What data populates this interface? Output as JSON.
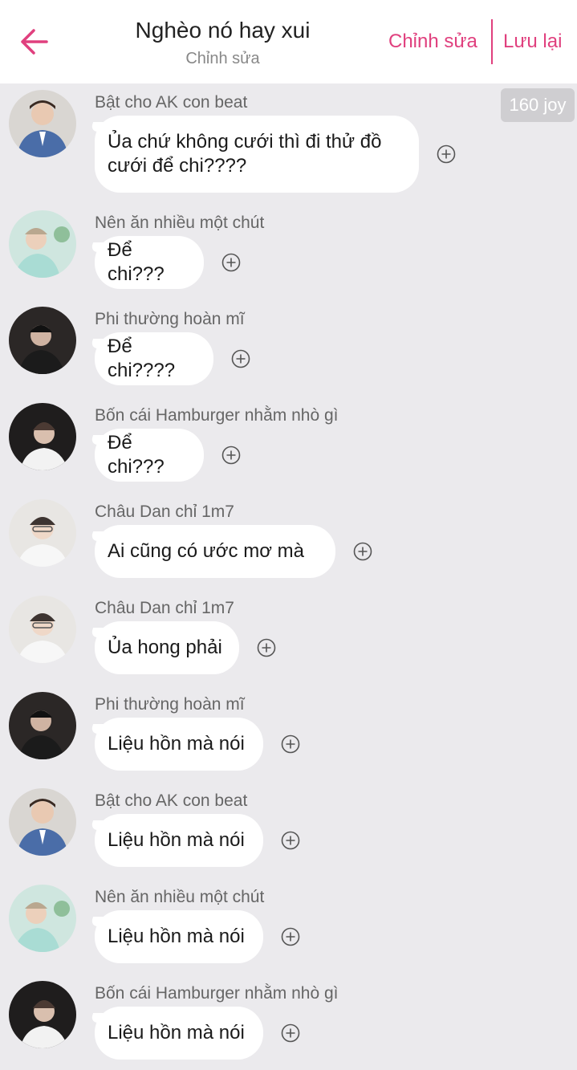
{
  "header": {
    "title": "Nghèo nó hay xui",
    "subtitle": "Chỉnh sửa",
    "edit_label": "Chỉnh sửa",
    "save_label": "Lưu lại"
  },
  "joy_badge": "160 joy",
  "colors": {
    "accent": "#e0407e",
    "background": "#ebeaed",
    "bubble": "#ffffff"
  },
  "messages": [
    {
      "sender": "Bật cho AK con beat",
      "text_lines": [
        "Ủa chứ không cưới thì đi thử đồ",
        "cưới để chi????"
      ],
      "avatar": "avatar-blue-suit"
    },
    {
      "sender": "Nên ăn nhiều một chút",
      "text_lines": [
        "Để chi???"
      ],
      "avatar": "avatar-pastel"
    },
    {
      "sender": "Phi thường hoàn mĩ",
      "text_lines": [
        "Để chi????"
      ],
      "avatar": "avatar-dark"
    },
    {
      "sender": "Bốn cái Hamburger nhằm nhò gì",
      "text_lines": [
        "Để chi???"
      ],
      "avatar": "avatar-dark-2"
    },
    {
      "sender": "Châu Dan chỉ 1m7",
      "text_lines": [
        "Ai cũng có ước mơ mà"
      ],
      "avatar": "avatar-light"
    },
    {
      "sender": "Châu Dan chỉ 1m7",
      "text_lines": [
        "Ủa hong phải"
      ],
      "avatar": "avatar-light"
    },
    {
      "sender": "Phi thường hoàn mĩ",
      "text_lines": [
        "Liệu hồn mà nói"
      ],
      "avatar": "avatar-dark"
    },
    {
      "sender": "Bật cho AK con beat",
      "text_lines": [
        "Liệu hồn mà nói"
      ],
      "avatar": "avatar-blue-suit"
    },
    {
      "sender": "Nên ăn nhiều một chút",
      "text_lines": [
        "Liệu hồn mà nói"
      ],
      "avatar": "avatar-pastel"
    },
    {
      "sender": "Bốn cái Hamburger nhằm nhò gì",
      "text_lines": [
        "Liệu hồn mà nói"
      ],
      "avatar": "avatar-dark-2"
    }
  ],
  "icons": {
    "back": "arrow-left-icon",
    "add": "plus-circle-icon"
  }
}
